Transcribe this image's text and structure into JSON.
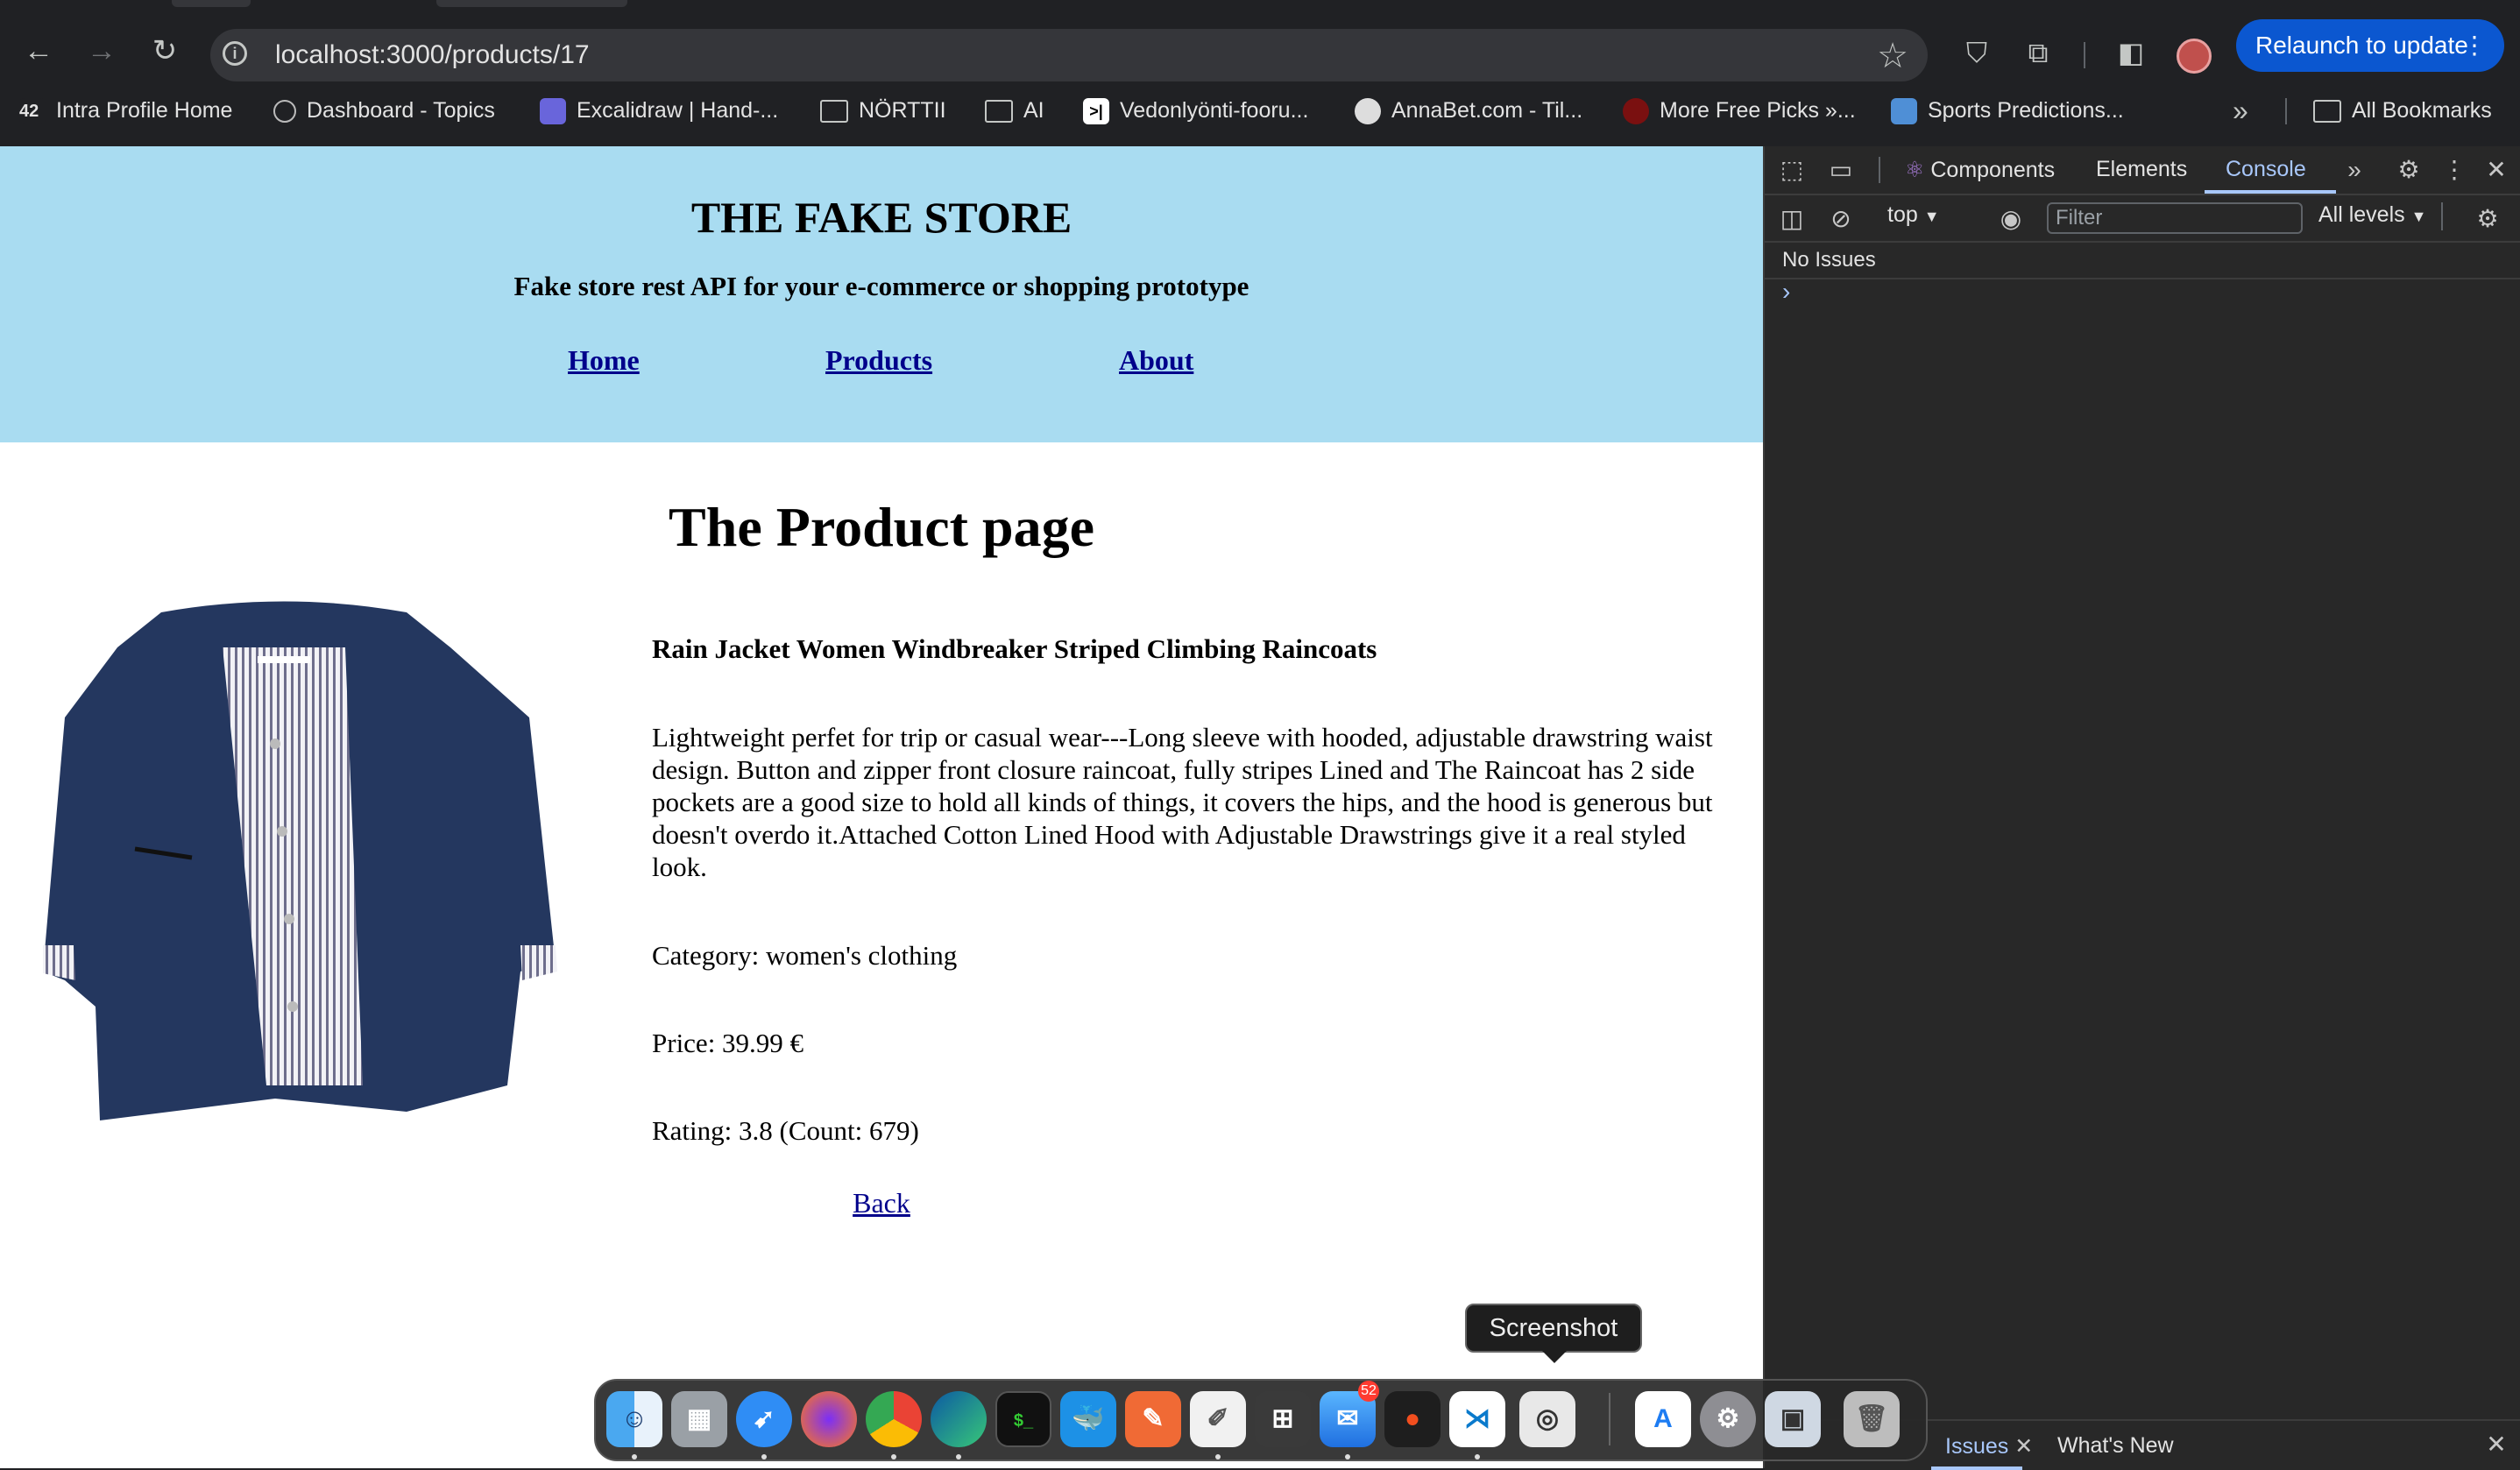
{
  "browser": {
    "url": "localhost:3000/products/17",
    "relaunch_label": "Relaunch to update",
    "bookmarks": [
      {
        "label": "Intra Profile Home",
        "icon": "intra-icon"
      },
      {
        "label": "Dashboard - Topics",
        "icon": "dashboard-icon"
      },
      {
        "label": "Excalidraw | Hand-...",
        "icon": "excalidraw-icon"
      },
      {
        "label": "NÖRTTII",
        "icon": "folder-icon"
      },
      {
        "label": "AI",
        "icon": "folder-icon"
      },
      {
        "label": "Vedonlyönti-fooru...",
        "icon": "terminal-icon"
      },
      {
        "label": "AnnaBet.com - Til...",
        "icon": "soccer-ball-icon"
      },
      {
        "label": "More Free Picks »...",
        "icon": "picks-icon"
      },
      {
        "label": "Sports Predictions...",
        "icon": "predictions-icon"
      }
    ],
    "all_bookmarks_label": "All Bookmarks"
  },
  "site": {
    "title": "THE FAKE STORE",
    "subtitle": "Fake store rest API for your e-commerce or shopping prototype",
    "nav": [
      "Home",
      "Products",
      "About"
    ]
  },
  "product": {
    "heading": "The Product page",
    "title": "Rain Jacket Women Windbreaker Striped Climbing Raincoats",
    "description": "Lightweight perfet for trip or casual wear---Long sleeve with hooded, adjustable drawstring waist design. Button and zipper front closure raincoat, fully stripes Lined and The Raincoat has 2 side pockets are a good size to hold all kinds of things, it covers the hips, and the hood is generous but doesn't overdo it.Attached Cotton Lined Hood with Adjustable Drawstrings give it a real styled look.",
    "category": "Category: women's clothing",
    "price": "Price: 39.99 €",
    "rating": "Rating: 3.8 (Count: 679)",
    "back_label": "Back"
  },
  "devtools": {
    "tabs": [
      "Components",
      "Elements",
      "Console"
    ],
    "active_tab": "Console",
    "context": "top",
    "filter_placeholder": "Filter",
    "levels": "All levels",
    "issues_text": "No Issues",
    "drawer_tabs": [
      "Issues",
      "What's New"
    ]
  },
  "dock": {
    "tooltip": "Screenshot",
    "mail_badge": "52",
    "apps": [
      "finder-icon",
      "launchpad-icon",
      "safari-icon",
      "firefox-icon",
      "chrome-icon",
      "edge-icon",
      "terminal-app-icon",
      "docker-icon",
      "pages-icon",
      "textedit-icon",
      "calculator-icon",
      "mail-icon",
      "figma-icon",
      "vscode-icon",
      "screenshot-icon",
      "appstore-icon",
      "settings-icon",
      "preview-icon",
      "trash-icon"
    ]
  },
  "colors": {
    "header_bg": "#a9dcf1",
    "link": "#00008b",
    "relaunch": "#0b57d0",
    "devtools_bg": "#282828"
  }
}
